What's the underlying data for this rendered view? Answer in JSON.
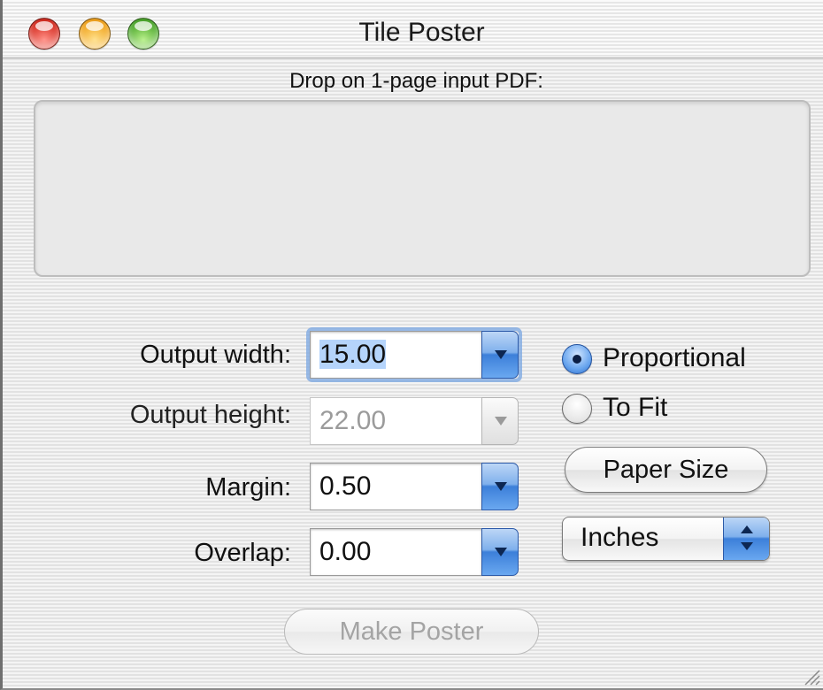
{
  "window": {
    "title": "Tile Poster",
    "controls": [
      "close-button",
      "minimize-button",
      "zoom-button"
    ]
  },
  "drop_area": {
    "label": "Drop on 1-page input PDF:"
  },
  "fields": {
    "output_width": {
      "label": "Output width:",
      "value": "15.00",
      "focused": true
    },
    "output_height": {
      "label": "Output height:",
      "value": "22.00",
      "disabled": true
    },
    "margin": {
      "label": "Margin:",
      "value": "0.50"
    },
    "overlap": {
      "label": "Overlap:",
      "value": "0.00"
    }
  },
  "scaling": {
    "options": [
      {
        "label": "Proportional",
        "selected": true
      },
      {
        "label": "To Fit",
        "selected": false
      }
    ]
  },
  "buttons": {
    "paper_size": "Paper Size",
    "make_poster": "Make Poster",
    "make_poster_enabled": false
  },
  "units_popup": {
    "selected": "Inches"
  },
  "colors": {
    "accent_blue": "#3c7fd9",
    "focus_ring": "#78a5e1",
    "close": "#d42a1e",
    "minimize": "#f0a21b",
    "zoom": "#4aa62a"
  }
}
